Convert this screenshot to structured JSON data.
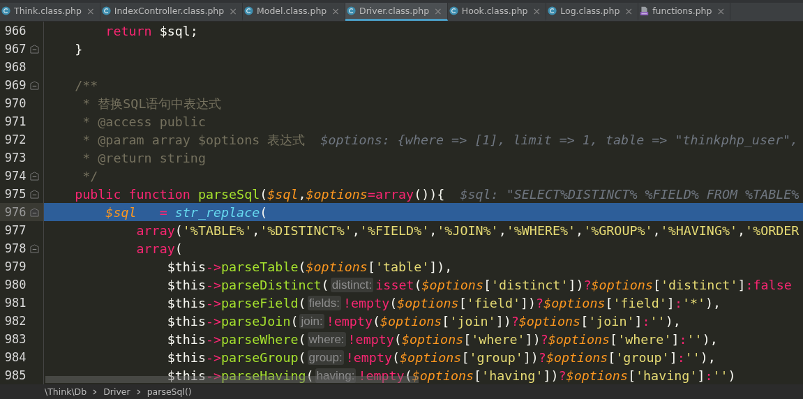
{
  "tabs": [
    {
      "label": "Think.class.php",
      "kind": "class",
      "selected": false,
      "close": "×"
    },
    {
      "label": "IndexController.class.php",
      "kind": "class",
      "selected": false,
      "close": "×"
    },
    {
      "label": "Model.class.php",
      "kind": "class",
      "selected": false,
      "close": "×"
    },
    {
      "label": "Driver.class.php",
      "kind": "class",
      "selected": true,
      "close": "×"
    },
    {
      "label": "Hook.class.php",
      "kind": "class",
      "selected": false,
      "close": "×"
    },
    {
      "label": "Log.class.php",
      "kind": "class",
      "selected": false,
      "close": "×"
    },
    {
      "label": "functions.php",
      "kind": "php",
      "selected": false,
      "close": "×"
    }
  ],
  "lines": [
    {
      "number": "966",
      "fold": false,
      "selected": false,
      "tokens": [
        {
          "kind": "kw",
          "text": "        return "
        },
        {
          "kind": "plain",
          "text": "$sql;"
        }
      ]
    },
    {
      "number": "967",
      "fold": true,
      "selected": false,
      "tokens": [
        {
          "kind": "plain",
          "text": "    }"
        }
      ]
    },
    {
      "number": "968",
      "fold": false,
      "selected": false
    },
    {
      "number": "969",
      "fold": true,
      "selected": false,
      "tokens": [
        {
          "kind": "comment",
          "text": "    /**"
        }
      ]
    },
    {
      "number": "970",
      "fold": false,
      "selected": false,
      "tokens": [
        {
          "kind": "comment",
          "text": "     * 替换SQL语句中表达式"
        }
      ]
    },
    {
      "number": "971",
      "fold": false,
      "selected": false,
      "tokens": [
        {
          "kind": "comment",
          "text": "     * @access public"
        }
      ]
    },
    {
      "number": "972",
      "fold": false,
      "selected": false,
      "tokens": [
        {
          "kind": "comment",
          "text": "     * @param array $options 表达式  "
        },
        {
          "kind": "debug",
          "text": "$options: {where => [1], limit => 1, table => \"thinkphp_user\","
        }
      ]
    },
    {
      "number": "973",
      "fold": false,
      "selected": false,
      "tokens": [
        {
          "kind": "comment",
          "text": "     * @return string"
        }
      ]
    },
    {
      "number": "974",
      "fold": true,
      "selected": false,
      "tokens": [
        {
          "kind": "comment",
          "text": "     */"
        }
      ]
    },
    {
      "number": "975",
      "fold": true,
      "selected": false,
      "tokens": [
        {
          "kind": "kw",
          "text": "    public function "
        },
        {
          "kind": "fn",
          "text": "parseSql"
        },
        {
          "kind": "plain",
          "text": "("
        },
        {
          "kind": "var",
          "text": "$sql"
        },
        {
          "kind": "plain",
          "text": ","
        },
        {
          "kind": "var",
          "text": "$options"
        },
        {
          "kind": "kw",
          "text": "=array"
        },
        {
          "kind": "plain",
          "text": "()){  "
        },
        {
          "kind": "debug",
          "text": "$sql: \"SELECT%DISTINCT% %FIELD% FROM %TABLE%"
        }
      ]
    },
    {
      "number": "976",
      "fold": true,
      "selected": true,
      "tokens": [
        {
          "kind": "var",
          "text": "        $sql   "
        },
        {
          "kind": "kw",
          "text": "= "
        },
        {
          "kind": "call",
          "text": "str_replace"
        },
        {
          "kind": "plain",
          "text": "("
        }
      ]
    },
    {
      "number": "977",
      "fold": false,
      "selected": false,
      "tokens": [
        {
          "kind": "kw",
          "text": "            array"
        },
        {
          "kind": "plain",
          "text": "("
        },
        {
          "kind": "str",
          "text": "'%TABLE%'"
        },
        {
          "kind": "plain",
          "text": ","
        },
        {
          "kind": "str",
          "text": "'%DISTINCT%'"
        },
        {
          "kind": "plain",
          "text": ","
        },
        {
          "kind": "str",
          "text": "'%FIELD%'"
        },
        {
          "kind": "plain",
          "text": ","
        },
        {
          "kind": "str",
          "text": "'%JOIN%'"
        },
        {
          "kind": "plain",
          "text": ","
        },
        {
          "kind": "str",
          "text": "'%WHERE%'"
        },
        {
          "kind": "plain",
          "text": ","
        },
        {
          "kind": "str",
          "text": "'%GROUP%'"
        },
        {
          "kind": "plain",
          "text": ","
        },
        {
          "kind": "str",
          "text": "'%HAVING%'"
        },
        {
          "kind": "plain",
          "text": ","
        },
        {
          "kind": "str",
          "text": "'%ORDER"
        }
      ]
    },
    {
      "number": "978",
      "fold": true,
      "selected": false,
      "tokens": [
        {
          "kind": "kw",
          "text": "            array"
        },
        {
          "kind": "plain",
          "text": "("
        }
      ]
    },
    {
      "number": "979",
      "fold": false,
      "selected": false,
      "tokens": [
        {
          "kind": "plain",
          "text": "                $this"
        },
        {
          "kind": "kw",
          "text": "->"
        },
        {
          "kind": "fn",
          "text": "parseTable"
        },
        {
          "kind": "plain",
          "text": "("
        },
        {
          "kind": "var",
          "text": "$options"
        },
        {
          "kind": "plain",
          "text": "["
        },
        {
          "kind": "str",
          "text": "'table'"
        },
        {
          "kind": "plain",
          "text": "]),"
        }
      ]
    },
    {
      "number": "980",
      "fold": false,
      "selected": false,
      "tokens": [
        {
          "kind": "plain",
          "text": "                $this"
        },
        {
          "kind": "kw",
          "text": "->"
        },
        {
          "kind": "fn",
          "text": "parseDistinct"
        },
        {
          "kind": "plain",
          "text": "("
        },
        {
          "kind": "hint",
          "text": "distinct:"
        },
        {
          "kind": "kw",
          "text": "isset"
        },
        {
          "kind": "plain",
          "text": "("
        },
        {
          "kind": "var",
          "text": "$options"
        },
        {
          "kind": "plain",
          "text": "["
        },
        {
          "kind": "str",
          "text": "'distinct'"
        },
        {
          "kind": "plain",
          "text": "])"
        },
        {
          "kind": "kw",
          "text": "?"
        },
        {
          "kind": "var",
          "text": "$options"
        },
        {
          "kind": "plain",
          "text": "["
        },
        {
          "kind": "str",
          "text": "'distinct'"
        },
        {
          "kind": "plain",
          "text": "]"
        },
        {
          "kind": "kw",
          "text": ":false"
        }
      ]
    },
    {
      "number": "981",
      "fold": false,
      "selected": false,
      "tokens": [
        {
          "kind": "plain",
          "text": "                $this"
        },
        {
          "kind": "kw",
          "text": "->"
        },
        {
          "kind": "fn",
          "text": "parseField"
        },
        {
          "kind": "plain",
          "text": "("
        },
        {
          "kind": "hint",
          "text": "fields:"
        },
        {
          "kind": "kw",
          "text": "!empty"
        },
        {
          "kind": "plain",
          "text": "("
        },
        {
          "kind": "var",
          "text": "$options"
        },
        {
          "kind": "plain",
          "text": "["
        },
        {
          "kind": "str",
          "text": "'field'"
        },
        {
          "kind": "plain",
          "text": "])"
        },
        {
          "kind": "kw",
          "text": "?"
        },
        {
          "kind": "var",
          "text": "$options"
        },
        {
          "kind": "plain",
          "text": "["
        },
        {
          "kind": "str",
          "text": "'field'"
        },
        {
          "kind": "plain",
          "text": "]"
        },
        {
          "kind": "kw",
          "text": ":"
        },
        {
          "kind": "str",
          "text": "'*'"
        },
        {
          "kind": "plain",
          "text": "),"
        }
      ]
    },
    {
      "number": "982",
      "fold": false,
      "selected": false,
      "tokens": [
        {
          "kind": "plain",
          "text": "                $this"
        },
        {
          "kind": "kw",
          "text": "->"
        },
        {
          "kind": "fn",
          "text": "parseJoin"
        },
        {
          "kind": "plain",
          "text": "("
        },
        {
          "kind": "hint",
          "text": "join:"
        },
        {
          "kind": "kw",
          "text": "!empty"
        },
        {
          "kind": "plain",
          "text": "("
        },
        {
          "kind": "var",
          "text": "$options"
        },
        {
          "kind": "plain",
          "text": "["
        },
        {
          "kind": "str",
          "text": "'join'"
        },
        {
          "kind": "plain",
          "text": "])"
        },
        {
          "kind": "kw",
          "text": "?"
        },
        {
          "kind": "var",
          "text": "$options"
        },
        {
          "kind": "plain",
          "text": "["
        },
        {
          "kind": "str",
          "text": "'join'"
        },
        {
          "kind": "plain",
          "text": "]"
        },
        {
          "kind": "kw",
          "text": ":"
        },
        {
          "kind": "str",
          "text": "''"
        },
        {
          "kind": "plain",
          "text": "),"
        }
      ]
    },
    {
      "number": "983",
      "fold": false,
      "selected": false,
      "tokens": [
        {
          "kind": "plain",
          "text": "                $this"
        },
        {
          "kind": "kw",
          "text": "->"
        },
        {
          "kind": "fn",
          "text": "parseWhere"
        },
        {
          "kind": "plain",
          "text": "("
        },
        {
          "kind": "hint",
          "text": "where:"
        },
        {
          "kind": "kw",
          "text": "!empty"
        },
        {
          "kind": "plain",
          "text": "("
        },
        {
          "kind": "var",
          "text": "$options"
        },
        {
          "kind": "plain",
          "text": "["
        },
        {
          "kind": "str",
          "text": "'where'"
        },
        {
          "kind": "plain",
          "text": "])"
        },
        {
          "kind": "kw",
          "text": "?"
        },
        {
          "kind": "var",
          "text": "$options"
        },
        {
          "kind": "plain",
          "text": "["
        },
        {
          "kind": "str",
          "text": "'where'"
        },
        {
          "kind": "plain",
          "text": "]"
        },
        {
          "kind": "kw",
          "text": ":"
        },
        {
          "kind": "str",
          "text": "''"
        },
        {
          "kind": "plain",
          "text": "),"
        }
      ]
    },
    {
      "number": "984",
      "fold": false,
      "selected": false,
      "tokens": [
        {
          "kind": "plain",
          "text": "                $this"
        },
        {
          "kind": "kw",
          "text": "->"
        },
        {
          "kind": "fn",
          "text": "parseGroup"
        },
        {
          "kind": "plain",
          "text": "("
        },
        {
          "kind": "hint",
          "text": "group:"
        },
        {
          "kind": "kw",
          "text": "!empty"
        },
        {
          "kind": "plain",
          "text": "("
        },
        {
          "kind": "var",
          "text": "$options"
        },
        {
          "kind": "plain",
          "text": "["
        },
        {
          "kind": "str",
          "text": "'group'"
        },
        {
          "kind": "plain",
          "text": "])"
        },
        {
          "kind": "kw",
          "text": "?"
        },
        {
          "kind": "var",
          "text": "$options"
        },
        {
          "kind": "plain",
          "text": "["
        },
        {
          "kind": "str",
          "text": "'group'"
        },
        {
          "kind": "plain",
          "text": "]"
        },
        {
          "kind": "kw",
          "text": ":"
        },
        {
          "kind": "str",
          "text": "''"
        },
        {
          "kind": "plain",
          "text": "),"
        }
      ]
    },
    {
      "number": "985",
      "fold": false,
      "selected": false,
      "tokens": [
        {
          "kind": "plain",
          "text": "                $this"
        },
        {
          "kind": "kw",
          "text": "->"
        },
        {
          "kind": "fn",
          "text": "parseHaving"
        },
        {
          "kind": "plain",
          "text": "("
        },
        {
          "kind": "hint",
          "text": "having:"
        },
        {
          "kind": "kw",
          "text": "!empty"
        },
        {
          "kind": "plain",
          "text": "("
        },
        {
          "kind": "var",
          "text": "$options"
        },
        {
          "kind": "plain",
          "text": "["
        },
        {
          "kind": "str",
          "text": "'having'"
        },
        {
          "kind": "plain",
          "text": "])"
        },
        {
          "kind": "kw",
          "text": "?"
        },
        {
          "kind": "var",
          "text": "$options"
        },
        {
          "kind": "plain",
          "text": "["
        },
        {
          "kind": "str",
          "text": "'having'"
        },
        {
          "kind": "plain",
          "text": "]"
        },
        {
          "kind": "kw",
          "text": ":"
        },
        {
          "kind": "str",
          "text": "''"
        },
        {
          "kind": "plain",
          "text": ")"
        }
      ]
    }
  ],
  "breadcrumbs": [
    "\\Think\\Db",
    "Driver",
    "parseSql()"
  ]
}
